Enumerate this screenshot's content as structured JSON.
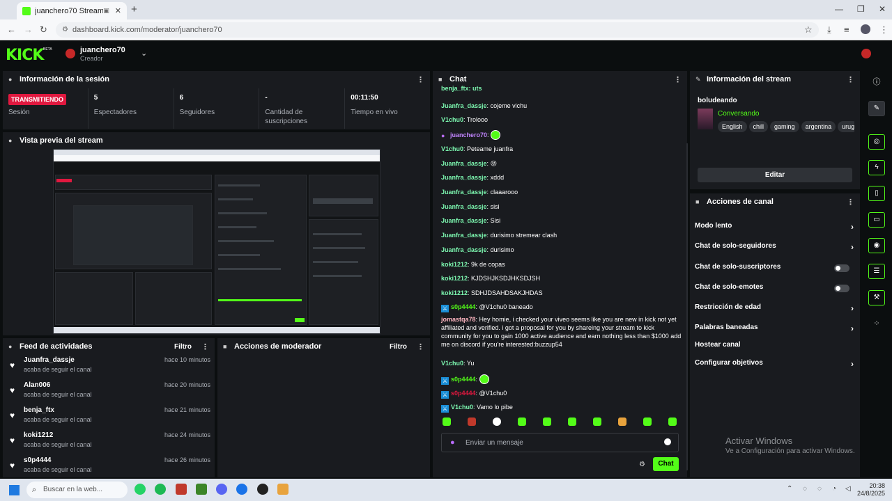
{
  "browser": {
    "tab_title": "juanchero70 Stream - Kick",
    "url": "dashboard.kick.com/moderator/juanchero70"
  },
  "header": {
    "logo": "KICK",
    "beta": "BETA",
    "username": "juanchero70",
    "role": "Creador"
  },
  "session": {
    "title": "Información de la sesión",
    "live_badge": "TRANSMITIENDO",
    "live_label": "Sesión",
    "stats": [
      {
        "value": "5",
        "label": "Espectadores"
      },
      {
        "value": "6",
        "label": "Seguidores"
      },
      {
        "value": "-",
        "label": "Cantidad de suscripciones"
      },
      {
        "value": "00:11:50",
        "label": "Tiempo en vivo"
      }
    ]
  },
  "preview": {
    "title": "Vista previa del stream"
  },
  "feed": {
    "title": "Feed de actividades",
    "filter": "Filtro",
    "items": [
      {
        "name": "Juanfra_dassje",
        "action": "acaba de seguir el canal",
        "time": "hace 10 minutos"
      },
      {
        "name": "Alan006",
        "action": "acaba de seguir el canal",
        "time": "hace 20 minutos"
      },
      {
        "name": "benja_ftx",
        "action": "acaba de seguir el canal",
        "time": "hace 21 minutos"
      },
      {
        "name": "koki1212",
        "action": "acaba de seguir el canal",
        "time": "hace 24 minutos"
      },
      {
        "name": "s0p4444",
        "action": "acaba de seguir el canal",
        "time": "hace 26 minutos"
      }
    ]
  },
  "mod_actions": {
    "title": "Acciones de moderador",
    "filter": "Filtro"
  },
  "chat": {
    "title": "Chat",
    "messages": [
      {
        "user": "Juanfra_dassje",
        "color": "#7df9b1",
        "text": "cojeme vichu"
      },
      {
        "user": "V1chu0",
        "color": "#7df9b1",
        "text": "Trolooo"
      },
      {
        "user": "juanchero70",
        "color": "#c084fc",
        "text": "",
        "badge": "mic",
        "emote": true
      },
      {
        "user": "V1chu0",
        "color": "#7df9b1",
        "text": "Peteame juanfra"
      },
      {
        "user": "Juanfra_dassje",
        "color": "#7df9b1",
        "text": "😝"
      },
      {
        "user": "Juanfra_dassje",
        "color": "#7df9b1",
        "text": "xddd"
      },
      {
        "user": "Juanfra_dassje",
        "color": "#7df9b1",
        "text": "claaarooo"
      },
      {
        "user": "Juanfra_dassje",
        "color": "#7df9b1",
        "text": "sisi"
      },
      {
        "user": "Juanfra_dassje",
        "color": "#7df9b1",
        "text": "Sisi"
      },
      {
        "user": "Juanfra_dassje",
        "color": "#7df9b1",
        "text": "durisimo stremear clash"
      },
      {
        "user": "Juanfra_dassje",
        "color": "#7df9b1",
        "text": "durisimo"
      },
      {
        "user": "koki1212",
        "color": "#7df9b1",
        "text": "9k de copas"
      },
      {
        "user": "koki1212",
        "color": "#7df9b1",
        "text": "KJDSHJKSDJHKSDJSH"
      },
      {
        "user": "koki1212",
        "color": "#7df9b1",
        "text": "SDHJDSAHDSAKJHDAS"
      },
      {
        "user": "s0p4444",
        "color": "#53fc18",
        "text": "@V1chu0 baneado",
        "badge": "mod"
      },
      {
        "user": "jomastqa78",
        "color": "#ffb6c1",
        "text": "Hey homie, i checked your viveo seems like you are new in kick not yet affiliated and verified. i got a proposal for you by shareing your stream to kick community for you to gain 1000 active audience and earn nothing less than $1000 add me on discord if you're interested:buzzup54"
      },
      {
        "user": "V1chu0",
        "color": "#7df9b1",
        "text": "Yu"
      },
      {
        "user": "s0p4444",
        "color": "#53fc18",
        "text": "",
        "badge": "mod",
        "emote": true
      },
      {
        "user": "s0p4444",
        "color": "#e0183f",
        "text": "@V1chu0",
        "badge": "mod"
      },
      {
        "user": "V1chu0",
        "color": "#7df9b1",
        "text": "Vamo lo pibe",
        "badge": "mod"
      }
    ],
    "input_placeholder": "Enviar un mensaje",
    "send_label": "Chat"
  },
  "stream_info": {
    "title": "Información del stream",
    "stream_title": "boludeando",
    "category": "Conversando",
    "tags": [
      "English",
      "chill",
      "gaming",
      "argentina",
      "urug"
    ],
    "edit_label": "Editar"
  },
  "channel_actions": {
    "title": "Acciones de canal",
    "items": [
      {
        "label": "Modo lento",
        "control": "chevron"
      },
      {
        "label": "Chat de solo-seguidores",
        "control": "chevron"
      },
      {
        "label": "Chat de solo-suscriptores",
        "control": "toggle"
      },
      {
        "label": "Chat de solo-emotes",
        "control": "toggle"
      },
      {
        "label": "Restricción de edad",
        "control": "chevron"
      },
      {
        "label": "Palabras baneadas",
        "control": "chevron"
      },
      {
        "label": "Hostear canal",
        "control": "none"
      },
      {
        "label": "Configurar objetivos",
        "control": "chevron"
      }
    ]
  },
  "watermark": {
    "line1": "Activar Windows",
    "line2": "Ve a Configuración para activar Windows."
  },
  "taskbar": {
    "search_placeholder": "Buscar en la web...",
    "time": "20:38",
    "date": "24/8/2025"
  },
  "colors": {
    "accent": "#53fc18",
    "live": "#e0183f",
    "panel": "#191b1f",
    "bg": "#0b0e0f"
  }
}
